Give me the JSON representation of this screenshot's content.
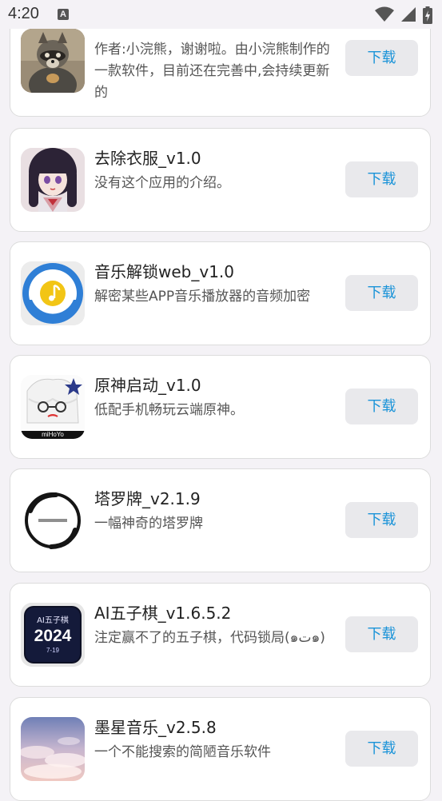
{
  "status_bar": {
    "time": "4:20",
    "notification_letter": "A",
    "icons": [
      "wifi-icon",
      "signal-icon",
      "battery-charging-icon"
    ]
  },
  "accent_color": "#1a93d8",
  "apps": [
    {
      "name": "",
      "desc": "作者:小浣熊，谢谢啦。由小浣熊制作的一款软件，目前还在完善中,会持续更新的",
      "button": "下载",
      "icon": "raccoon-avatar-icon"
    },
    {
      "name": "去除衣服_v1.0",
      "desc": "没有这个应用的介绍。",
      "button": "下载",
      "icon": "anime-girl-avatar-icon"
    },
    {
      "name": "音乐解锁web_v1.0",
      "desc": "解密某些APP音乐播放器的音频加密",
      "button": "下载",
      "icon": "music-unlock-icon"
    },
    {
      "name": "原神启动_v1.0",
      "desc": "低配手机畅玩云端原神。",
      "button": "下载",
      "icon": "genshin-character-icon",
      "icon_text": "miHoYo"
    },
    {
      "name": "塔罗牌_v2.1.9",
      "desc": "一幅神奇的塔罗牌",
      "button": "下载",
      "icon": "tarot-ring-icon"
    },
    {
      "name": "AI五子棋_v1.6.5.2",
      "desc": "注定赢不了的五子棋，代码锁局(๑ت๑)",
      "button": "下载",
      "icon": "gomoku-2024-icon",
      "icon_text_top": "AI五子棋",
      "icon_text_main": "2024",
      "icon_text_bottom": "7-19"
    },
    {
      "name": "墨星音乐_v2.5.8",
      "desc": "一个不能搜索的简陋音乐软件",
      "button": "下载",
      "icon": "sky-clouds-icon"
    }
  ]
}
